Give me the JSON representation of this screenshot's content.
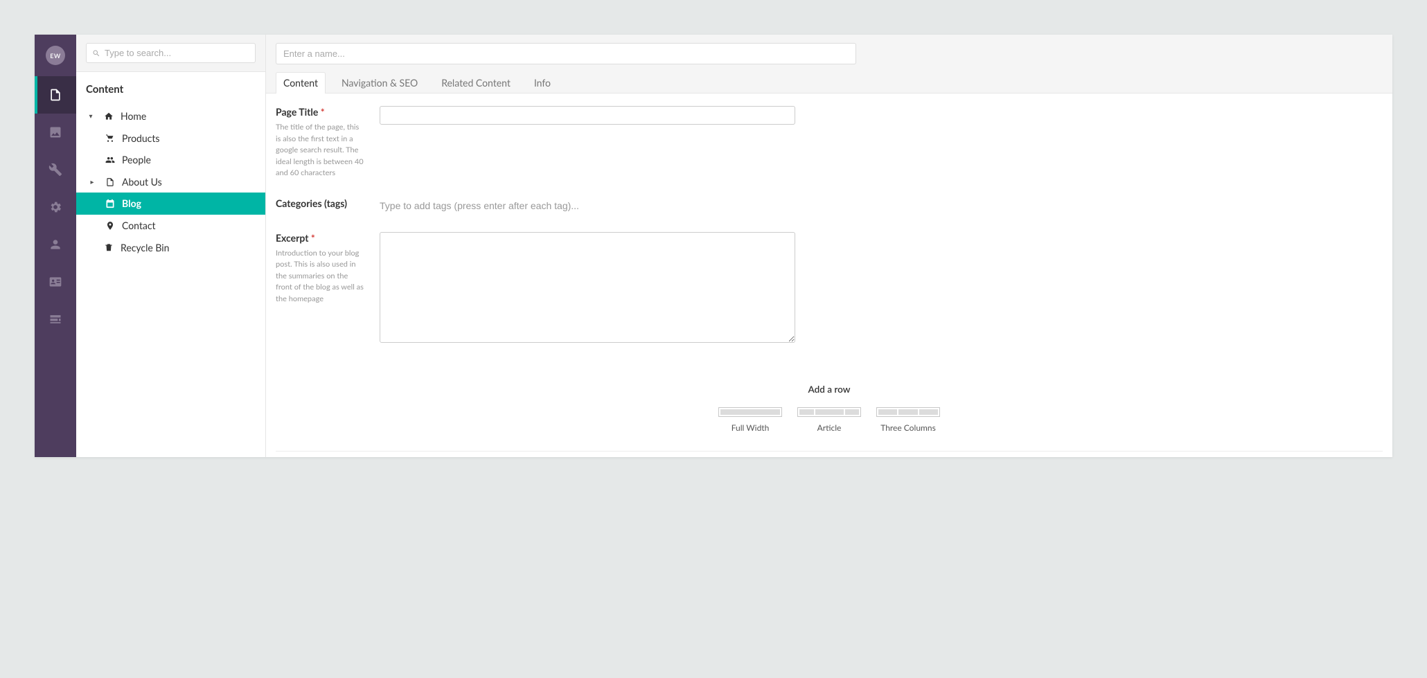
{
  "avatar_initials": "EW",
  "search_placeholder": "Type to search...",
  "tree": {
    "section_title": "Content",
    "root": {
      "label": "Home"
    },
    "children": [
      {
        "label": "Products"
      },
      {
        "label": "People"
      },
      {
        "label": "About Us"
      },
      {
        "label": "Blog"
      },
      {
        "label": "Contact"
      }
    ],
    "recycle_label": "Recycle Bin"
  },
  "name_placeholder": "Enter a name...",
  "tabs": [
    {
      "label": "Content"
    },
    {
      "label": "Navigation & SEO"
    },
    {
      "label": "Related Content"
    },
    {
      "label": "Info"
    }
  ],
  "fields": {
    "page_title": {
      "label": "Page Title",
      "help": "The title of the page, this is also the first text in a google search result. The ideal length is between 40 and 60 characters"
    },
    "categories": {
      "label": "Categories (tags)",
      "placeholder": "Type to add tags (press enter after each tag)..."
    },
    "excerpt": {
      "label": "Excerpt",
      "help": "Introduction to your blog post. This is also used in the summaries on the front of the blog as well as the homepage"
    }
  },
  "add_row": {
    "title": "Add a row",
    "layouts": [
      {
        "name": "Full Width"
      },
      {
        "name": "Article"
      },
      {
        "name": "Three Columns"
      }
    ]
  }
}
